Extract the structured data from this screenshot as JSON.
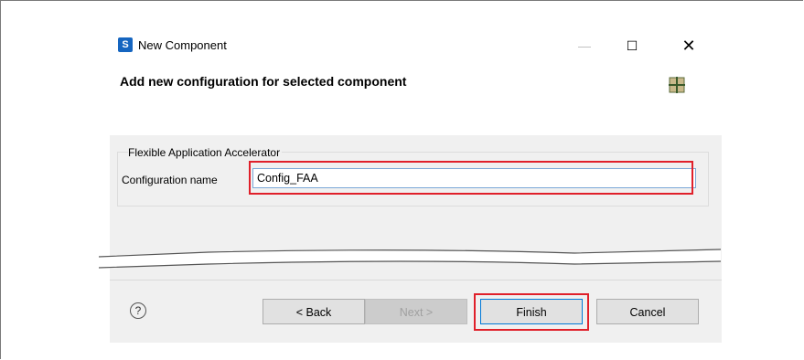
{
  "window": {
    "title": "New Component",
    "icon": "app-logo-icon",
    "controls": {
      "minimize": "—",
      "maximize": "☐",
      "close": "✕"
    }
  },
  "header": {
    "title": "Add new configuration for selected component",
    "icon": "component-grid-icon"
  },
  "group": {
    "label": "Flexible Application Accelerator",
    "field_label": "Configuration name",
    "field_value": "Config_FAA"
  },
  "footer": {
    "help": "?",
    "back_label": "< Back",
    "next_label": "Next >",
    "finish_label": "Finish",
    "cancel_label": "Cancel"
  },
  "colors": {
    "highlight": "#e0202a",
    "focus": "#0078d7"
  }
}
